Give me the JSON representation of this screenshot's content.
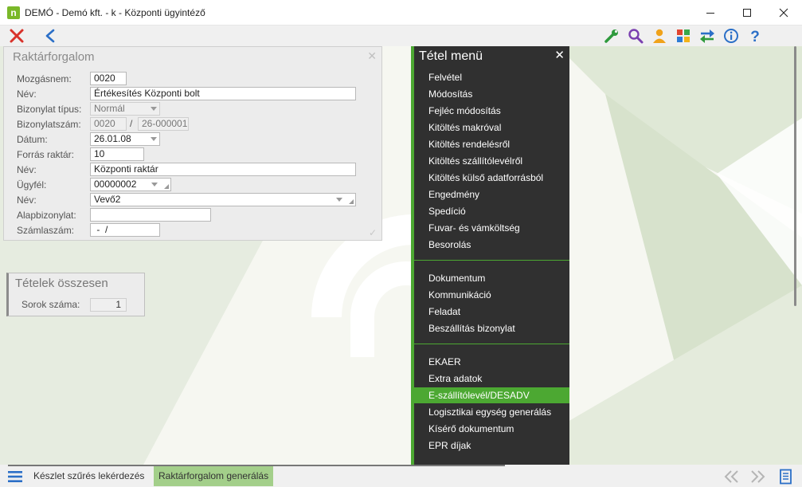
{
  "window": {
    "title": "DEMÓ - Demó kft. - k - Központi ügyintéző",
    "app_icon_letter": "n"
  },
  "toolbar": {
    "left_icons": [
      "close-icon",
      "back-icon"
    ],
    "right_icons": [
      "wrench-icon",
      "search-icon",
      "user-icon",
      "apps-icon",
      "swap-icon",
      "info-icon",
      "help-icon"
    ]
  },
  "form": {
    "title": "Raktárforgalom",
    "fields": {
      "mozgasnem": {
        "label": "Mozgásnem:",
        "value": "0020"
      },
      "nev1": {
        "label": "Név:",
        "value": "Értékesítés Központi bolt"
      },
      "bizonylat_tipus": {
        "label": "Bizonylat típus:",
        "value": "Normál"
      },
      "bizonylatszam": {
        "label": "Bizonylatszám:",
        "value_a": "0020",
        "sep": "/",
        "value_b": "26-000001"
      },
      "datum": {
        "label": "Dátum:",
        "value": "26.01.08"
      },
      "forras_raktar": {
        "label": "Forrás raktár:",
        "value": "10"
      },
      "nev2": {
        "label": "Név:",
        "value": "Központi raktár"
      },
      "ugyfel": {
        "label": "Ügyfél:",
        "value": "00000002"
      },
      "nev3": {
        "label": "Név:",
        "value": "Vevő2"
      },
      "alapbizonylat": {
        "label": "Alapbizonylat:",
        "value": ""
      },
      "szamlaszam": {
        "label": "Számlaszám:",
        "value": " -  /"
      }
    }
  },
  "totals": {
    "title": "Tételek összesen",
    "rows_label": "Sorok száma:",
    "rows_value": "1"
  },
  "menu": {
    "title": "Tétel menü",
    "group1": [
      "Felvétel",
      "Módosítás",
      "Fejléc módosítás",
      "Kitöltés makróval",
      "Kitöltés rendelésről",
      "Kitöltés szállítólevélről",
      "Kitöltés külső adatforrásból",
      "Engedmény",
      "Spedíció",
      "Fuvar- és vámköltség",
      "Besorolás"
    ],
    "group2": [
      "Dokumentum",
      "Kommunikáció",
      "Feladat",
      "Beszállítás bizonylat"
    ],
    "group3": [
      "EKAER",
      "Extra adatok",
      "E-szállítólevél/DESADV",
      "Logisztikai egység generálás",
      "Kísérő dokumentum",
      "EPR díjak"
    ],
    "active_item": "E-szállítólevél/DESADV",
    "accent_color": "#4ca832"
  },
  "bottom": {
    "tabs": [
      "Készlet szűrés lekérdezés",
      "Raktárforgalom generálás"
    ],
    "active_tab": "Raktárforgalom generálás"
  },
  "colors": {
    "menu_bg": "#303030",
    "accent": "#4ca832",
    "active_tab": "#a3cf8a",
    "close_red": "#d9322b",
    "back_blue": "#2b6fc7"
  }
}
